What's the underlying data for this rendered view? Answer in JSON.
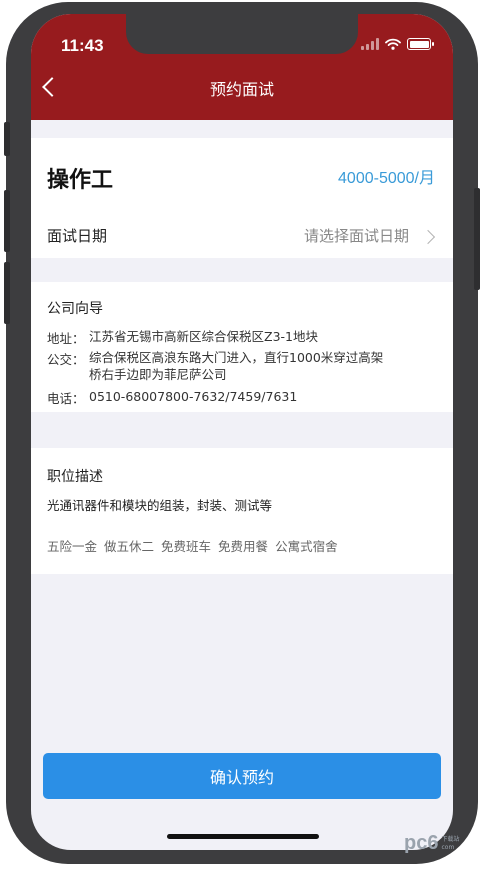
{
  "status_bar": {
    "time": "11:43"
  },
  "nav": {
    "title": "预约面试"
  },
  "job": {
    "title": "操作工",
    "salary": "4000-5000/月"
  },
  "interview_date": {
    "label": "面试日期",
    "placeholder": "请选择面试日期"
  },
  "company_guide": {
    "title": "公司向导",
    "address_label": "地址：",
    "address": "江苏省无锡市高新区综合保税区Z3-1地块",
    "transit_label": "公交：",
    "transit_line1": "综合保税区高浪东路大门进入，直行1000米穿过高架",
    "transit_line2": "桥右手边即为菲尼萨公司",
    "phone_label": "电话：",
    "phone": "0510-68007800-7632/7459/7631"
  },
  "job_description": {
    "title": "职位描述",
    "text": "光通讯器件和模块的组装，封装、测试等",
    "tags": [
      "五险一金",
      "做五休二",
      "免费班车",
      "免费用餐",
      "公寓式宿舍"
    ]
  },
  "confirm_button": {
    "label": "确认预约"
  },
  "watermark": {
    "text": "pc6",
    "sub1": "下载站",
    "sub2": "com"
  },
  "colors": {
    "header": "#971b1e",
    "accent_blue": "#2b8fe6",
    "salary_blue": "#3a9bd8",
    "background": "#f1f1f7"
  },
  "icons": [
    "back-arrow-icon",
    "signal-icon",
    "wifi-icon",
    "battery-icon",
    "chevron-right-icon"
  ]
}
